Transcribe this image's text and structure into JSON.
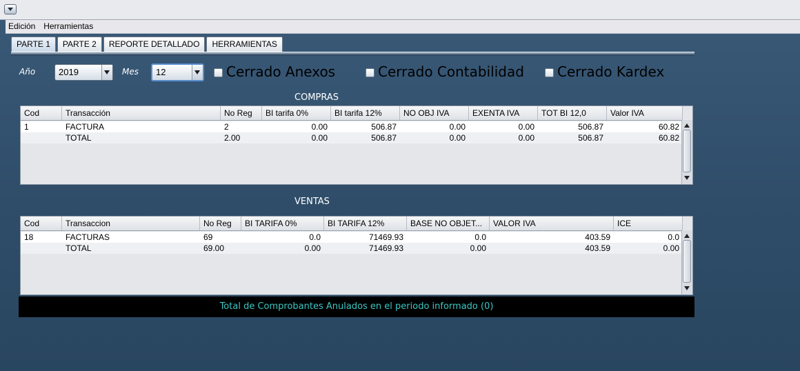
{
  "menu": {
    "items": [
      "Edición",
      "Herramientas"
    ]
  },
  "tabs": [
    {
      "label": "PARTE 1",
      "active": true
    },
    {
      "label": "PARTE 2",
      "active": false
    },
    {
      "label": "REPORTE DETALLADO",
      "active": false
    },
    {
      "label": "HERRAMIENTAS",
      "active": false
    }
  ],
  "filters": {
    "year_label": "Año",
    "year_value": "2019",
    "month_label": "Mes",
    "month_value": "12",
    "checks": [
      {
        "label": "Cerrado Anexos",
        "checked": false
      },
      {
        "label": "Cerrado Contabilidad",
        "checked": false
      },
      {
        "label": "Cerrado Kardex",
        "checked": false
      }
    ]
  },
  "compras": {
    "title": "COMPRAS",
    "headers": [
      "Cod",
      "Transacción",
      "No Reg",
      "BI tarifa 0%",
      "BI tarifa 12%",
      "NO OBJ IVA",
      "EXENTA IVA",
      "TOT BI 12,0",
      "Valor IVA"
    ],
    "rows": [
      [
        "1",
        "FACTURA",
        "2",
        "0.00",
        "506.87",
        "0.00",
        "0.00",
        "506.87",
        "60.82"
      ],
      [
        "",
        "TOTAL",
        "2.00",
        "0.00",
        "506.87",
        "0.00",
        "0.00",
        "506.87",
        "60.82"
      ]
    ]
  },
  "ventas": {
    "title": "VENTAS",
    "headers": [
      "Cod",
      "Transaccion",
      "No Reg",
      "BI TARIFA 0%",
      "BI TARIFA 12%",
      "BASE NO OBJET...",
      "VALOR IVA",
      "ICE"
    ],
    "rows": [
      [
        "18",
        "FACTURAS",
        "69",
        "0.0",
        "71469.93",
        "0.0",
        "403.59",
        "0.0"
      ],
      [
        "",
        "TOTAL",
        "69.00",
        "0.00",
        "71469.93",
        "0.00",
        "403.59",
        "0.00"
      ]
    ]
  },
  "footer": {
    "annulled_text": "Total de Comprobantes Anulados en el periodo informado  (0)"
  },
  "colors": {
    "background": "#34536f",
    "annul_text": "#3cc7c4",
    "annul_bg": "#000000"
  }
}
